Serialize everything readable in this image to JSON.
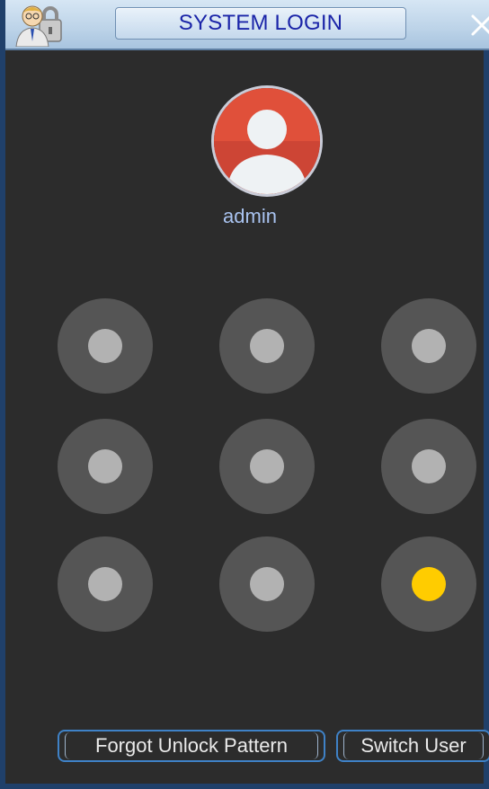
{
  "window": {
    "title": "SYSTEM LOGIN",
    "title_icon": "user-lock-icon",
    "close_icon": "close-icon"
  },
  "user": {
    "avatar_icon": "user-avatar-icon",
    "name": "admin"
  },
  "pattern": {
    "nodes": [
      {
        "id": 1,
        "active": false
      },
      {
        "id": 2,
        "active": false
      },
      {
        "id": 3,
        "active": false
      },
      {
        "id": 4,
        "active": false
      },
      {
        "id": 5,
        "active": false
      },
      {
        "id": 6,
        "active": false
      },
      {
        "id": 7,
        "active": false
      },
      {
        "id": 8,
        "active": false
      },
      {
        "id": 9,
        "active": true
      }
    ]
  },
  "buttons": {
    "forgot_label": "Forgot Unlock Pattern",
    "switch_label": "Switch User"
  },
  "colors": {
    "title_text": "#1a24a8",
    "username": "#a9c3f0",
    "active_dot": "#ffcc00",
    "inactive_dot": "#b2b2b2",
    "avatar_bg": "#e0503a"
  }
}
